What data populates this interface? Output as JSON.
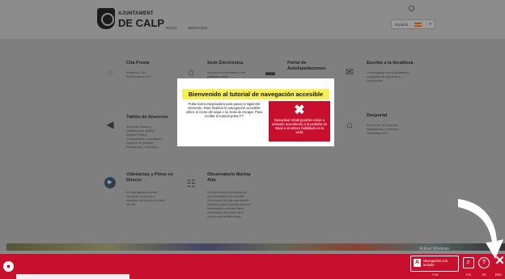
{
  "header": {
    "brand_line1": "AJUNTAMENT",
    "brand_line2": "DE CALP",
    "nav": [
      "INICIO",
      "SERVICIOS"
    ],
    "language": "Español"
  },
  "cards": [
    {
      "id": "cita",
      "title": "Cita Previa",
      "desc": "Solicite su Cita Previa para la OAC",
      "icon": "clock-icon",
      "glyph": "◌"
    },
    {
      "id": "sede",
      "title": "Sede Electrónica",
      "desc": "Acceda a la información y las gestiones online",
      "icon": "building-icon",
      "glyph": "⌂"
    },
    {
      "id": "portal",
      "title": "Portal de Autoliquidaciones",
      "desc": "",
      "icon": "card-icon",
      "glyph": "▬"
    },
    {
      "id": "alcaldesa",
      "title": "Escribe a la Alcaldesa",
      "desc": "Comuníquese con la Alcaldesa y explíquele sus opiniones y sugerencias",
      "icon": "mail-icon",
      "glyph": "✉"
    },
    {
      "id": "tablon",
      "title": "Tablón de Anuncios",
      "desc": "Anuncios, bandos y notificaciones. Boletín, Empleo Público, Convocatorias, expedientes, Órganos de gobierno, Presupuesto, Urbanismo",
      "icon": "megaphone-icon",
      "glyph": "◀"
    },
    {
      "id": "deporte",
      "title": "Desportal",
      "desc": "Bienvenido al Desportal. Instalaciones y reservas. Temporada 2021",
      "icon": "home-icon",
      "glyph": "⌂"
    },
    {
      "id": "videoactas",
      "title": "Videoactas y Pleno en Directo",
      "desc": "En este apartado puede visualizar los plenos y consultar los puntos del orden del día",
      "icon": "play-icon",
      "glyph": "▶"
    },
    {
      "id": "observatorio",
      "title": "Observatorio Marina Alta",
      "desc": "El Observatorio Marina Alta es una herramienta de consulta online para los y las agentes del territorio y para cualquier persona interesada en conocer datos estadísticos relevantes de la comarca de la Marina Alta",
      "icon": "chart-icon",
      "glyph": "☷"
    }
  ],
  "watermark": "Activar Windows",
  "modal": {
    "title": "Bienvenido al tutorial de navegación accesible",
    "text": "Pulse barra espaciadora para pasar al siguiente elemento. Para finalizar la navegación accesible utilice el icono del aspa o su tecla de escape. Para ocultar el tutorial pulse F7",
    "deactivate": "Desactivar Inbali (podrás volver a activarlo accediendo a la pestaña de Inbali o al enlace habilitado en la web)"
  },
  "toolbar": {
    "nav_label": "Navegación con teclado",
    "nav_key": "F10",
    "reader_key": "F11",
    "help_key": "F6",
    "close_key": "ESC",
    "colors": {
      "bar": "#c8102e",
      "highlight": "#f7ef55"
    }
  }
}
